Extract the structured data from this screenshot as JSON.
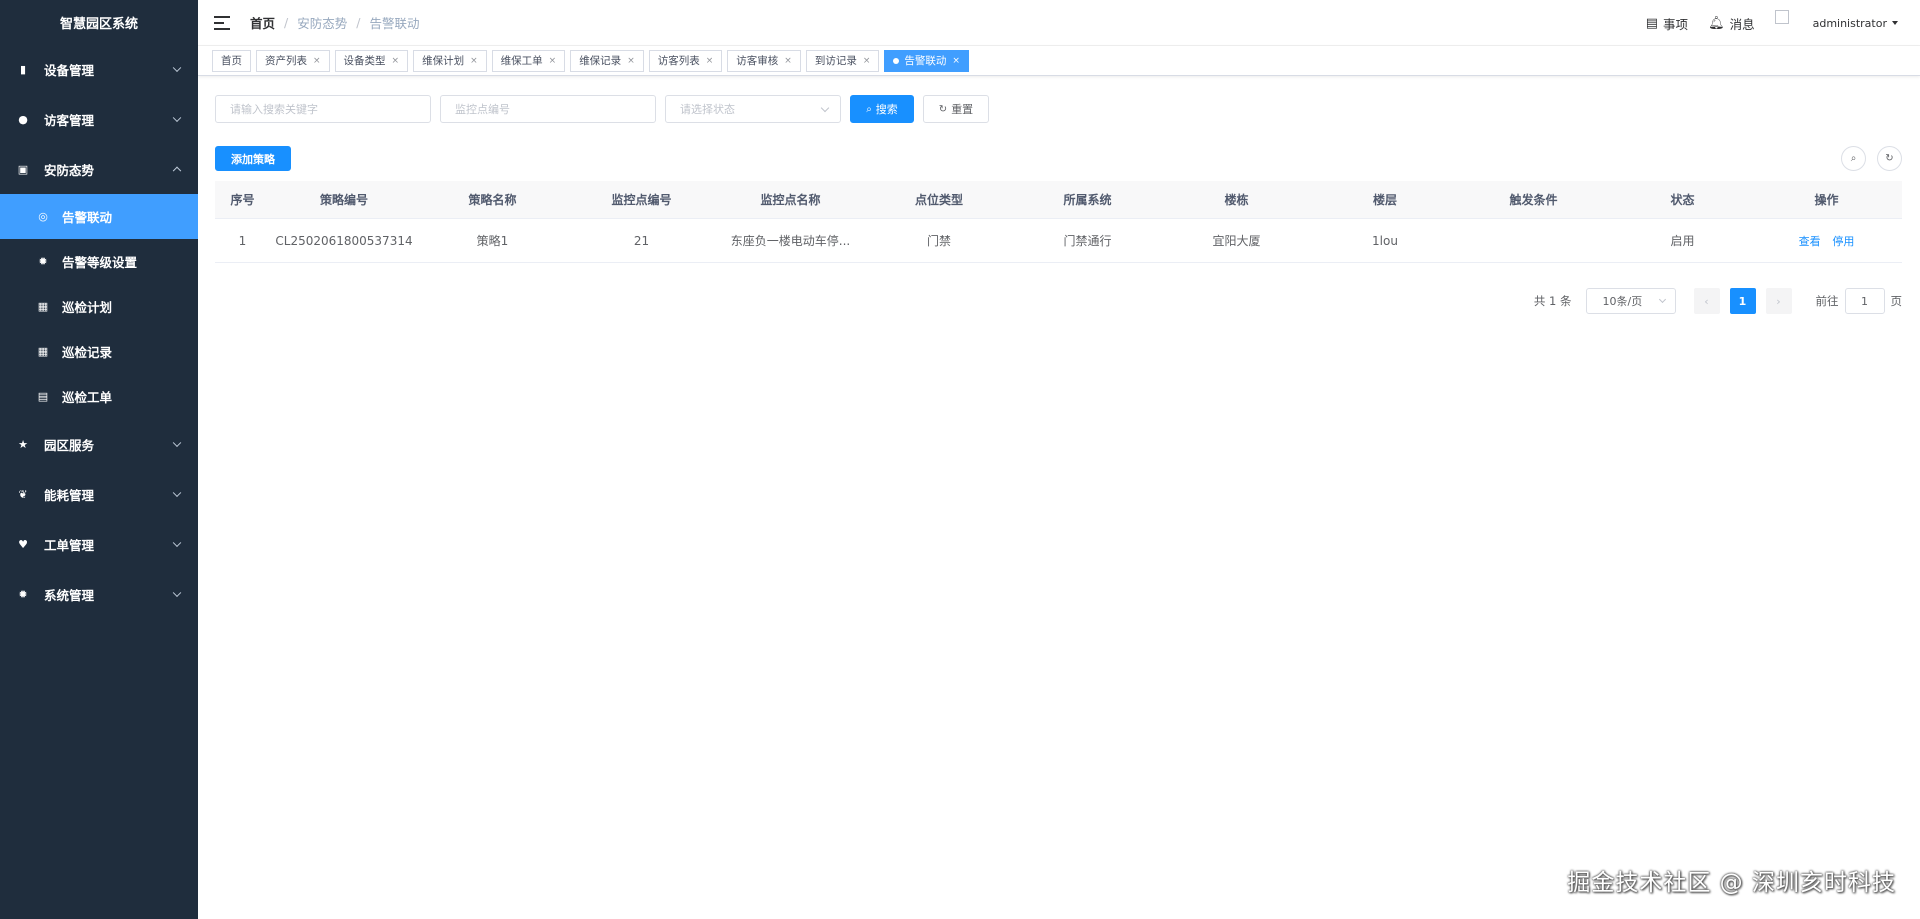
{
  "app": {
    "title": "智慧园区系统"
  },
  "sidebar": {
    "menus": [
      {
        "label": "设备管理",
        "icon": "bookmark-icon",
        "glyph": "▮"
      },
      {
        "label": "访客管理",
        "icon": "user-icon",
        "glyph": "●"
      },
      {
        "label": "安防态势",
        "icon": "lock-icon",
        "glyph": "▣",
        "expanded": true
      },
      {
        "label": "园区服务",
        "icon": "star-icon",
        "glyph": "★"
      },
      {
        "label": "能耗管理",
        "icon": "leaf-icon",
        "glyph": "❦"
      },
      {
        "label": "工单管理",
        "icon": "heart-icon",
        "glyph": "♥"
      },
      {
        "label": "系统管理",
        "icon": "gear-icon",
        "glyph": "✹"
      }
    ],
    "sub_items": [
      {
        "label": "告警联动",
        "icon": "alarm-icon",
        "glyph": "◎",
        "active": true
      },
      {
        "label": "告警等级设置",
        "icon": "gear-icon",
        "glyph": "✹"
      },
      {
        "label": "巡检计划",
        "icon": "grid-icon",
        "glyph": "▦"
      },
      {
        "label": "巡检记录",
        "icon": "grid-icon",
        "glyph": "▦"
      },
      {
        "label": "巡检工单",
        "icon": "list-icon",
        "glyph": "▤"
      }
    ]
  },
  "header": {
    "breadcrumb": [
      "首页",
      "安防态势",
      "告警联动"
    ],
    "todo_label": "事项",
    "message_label": "消息",
    "username": "administrator"
  },
  "tags": [
    {
      "label": "首页",
      "closable": false
    },
    {
      "label": "资产列表",
      "closable": true
    },
    {
      "label": "设备类型",
      "closable": true
    },
    {
      "label": "维保计划",
      "closable": true
    },
    {
      "label": "维保工单",
      "closable": true
    },
    {
      "label": "维保记录",
      "closable": true
    },
    {
      "label": "访客列表",
      "closable": true
    },
    {
      "label": "访客审核",
      "closable": true
    },
    {
      "label": "到访记录",
      "closable": true
    },
    {
      "label": "告警联动",
      "closable": true,
      "active": true
    }
  ],
  "filters": {
    "keyword_placeholder": "请输入搜索关键字",
    "point_placeholder": "监控点编号",
    "status_placeholder": "请选择状态",
    "search_label": "搜索",
    "reset_label": "重置"
  },
  "toolbar": {
    "add_label": "添加策略"
  },
  "table": {
    "columns": [
      "序号",
      "策略编号",
      "策略名称",
      "监控点编号",
      "监控点名称",
      "点位类型",
      "所属系统",
      "楼栋",
      "楼层",
      "触发条件",
      "状态",
      "操作"
    ],
    "rows": [
      [
        "1",
        "CL2502061800537314",
        "策略1",
        "21",
        "东座负一楼电动车停...",
        "门禁",
        "门禁通行",
        "宜阳大厦",
        "1lou",
        "",
        "启用"
      ]
    ],
    "actions": {
      "view": "查看",
      "disable": "停用"
    }
  },
  "pagination": {
    "total_text": "共 1 条",
    "page_size": "10条/页",
    "current_page": "1",
    "goto_prefix": "前往",
    "goto_value": "1",
    "goto_suffix": "页"
  },
  "watermark": "掘金技术社区 @ 深圳亥时科技",
  "colors": {
    "sidebar_bg": "#1f2d3d",
    "primary": "#1890ff",
    "active_menu": "#409eff"
  }
}
